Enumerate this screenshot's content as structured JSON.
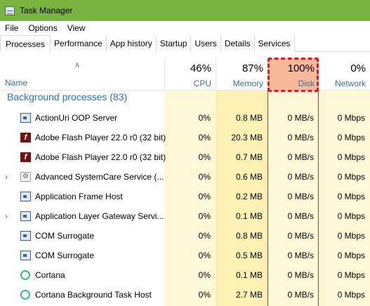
{
  "window": {
    "title": "Task Manager"
  },
  "menu": [
    "File",
    "Options",
    "View"
  ],
  "tabs": [
    "Processes",
    "Performance",
    "App history",
    "Startup",
    "Users",
    "Details",
    "Services"
  ],
  "active_tab": "Processes",
  "columns": {
    "name": {
      "label": "Name"
    },
    "cpu": {
      "percent": "46%",
      "label": "CPU"
    },
    "memory": {
      "percent": "87%",
      "label": "Memory"
    },
    "disk": {
      "percent": "100%",
      "label": "Disk"
    },
    "network": {
      "percent": "0%",
      "label": "Network"
    }
  },
  "group": {
    "label": "Background processes (83)"
  },
  "rows": [
    {
      "name": "ActionUri OOP Server",
      "icon": "window-icon",
      "expandable": false,
      "cpu": "0%",
      "memory": "0.8 MB",
      "disk": "0 MB/s",
      "network": "0 Mbps"
    },
    {
      "name": "Adobe Flash Player 22.0 r0 (32 bit)",
      "icon": "flash-icon",
      "expandable": false,
      "cpu": "0%",
      "memory": "20.3 MB",
      "disk": "0 MB/s",
      "network": "0 Mbps"
    },
    {
      "name": "Adobe Flash Player 22.0 r0 (32 bit)",
      "icon": "flash-icon",
      "expandable": false,
      "cpu": "0%",
      "memory": "0.7 MB",
      "disk": "0 MB/s",
      "network": "0 Mbps"
    },
    {
      "name": "Advanced SystemCare Service (...",
      "icon": "gear-icon",
      "expandable": true,
      "cpu": "0%",
      "memory": "0.6 MB",
      "disk": "0 MB/s",
      "network": "0 Mbps"
    },
    {
      "name": "Application Frame Host",
      "icon": "window-icon",
      "expandable": false,
      "cpu": "0%",
      "memory": "0.2 MB",
      "disk": "0 MB/s",
      "network": "0 Mbps"
    },
    {
      "name": "Application Layer Gateway Servi...",
      "icon": "window-icon",
      "expandable": true,
      "cpu": "0%",
      "memory": "0.1 MB",
      "disk": "0 MB/s",
      "network": "0 Mbps"
    },
    {
      "name": "COM Surrogate",
      "icon": "window-icon",
      "expandable": false,
      "cpu": "0%",
      "memory": "0.8 MB",
      "disk": "0 MB/s",
      "network": "0 Mbps"
    },
    {
      "name": "COM Surrogate",
      "icon": "window-icon",
      "expandable": false,
      "cpu": "0%",
      "memory": "0.5 MB",
      "disk": "0 MB/s",
      "network": "0 Mbps"
    },
    {
      "name": "Cortana",
      "icon": "cortana-icon",
      "expandable": false,
      "cpu": "0%",
      "memory": "0.1 MB",
      "disk": "0 MB/s",
      "network": "0 Mbps"
    },
    {
      "name": "Cortana Background Task Host",
      "icon": "cortana-icon",
      "expandable": false,
      "cpu": "0%",
      "memory": "2.7 MB",
      "disk": "0 MB/s",
      "network": "0 Mbps"
    }
  ],
  "colors": {
    "titlebar": "#7ab33f",
    "disk_header": "#f8b99b",
    "highlight": "#e01b1b",
    "group_label": "#2e6fc7"
  }
}
